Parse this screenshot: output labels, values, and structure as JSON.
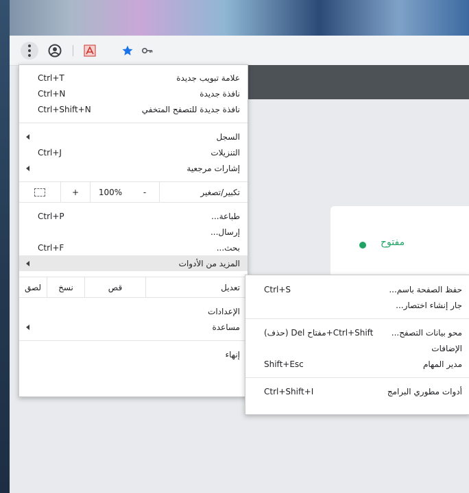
{
  "toolbar": {
    "menu_icon": "vertical-dots-icon",
    "profile_icon": "account-circle-icon",
    "pdf_icon": "acrobat-pdf-icon",
    "star_icon": "bookmark-star-icon",
    "key_icon": "key-icon"
  },
  "page": {
    "status_text": "مفتوح",
    "status_color": "#21a366"
  },
  "main_menu": {
    "new_tab": {
      "label": "علامة تبويب جديدة",
      "shortcut": "Ctrl+T"
    },
    "new_window": {
      "label": "نافذة جديدة",
      "shortcut": "Ctrl+N"
    },
    "incognito": {
      "label": "نافذة جديدة للتصفح المتخفي",
      "shortcut": "Ctrl+Shift+N"
    },
    "history": {
      "label": "السجل"
    },
    "downloads": {
      "label": "التنزيلات",
      "shortcut": "Ctrl+J"
    },
    "bookmarks": {
      "label": "إشارات مرجعية"
    },
    "zoom": {
      "label": "تكبير/تصغير",
      "minus": "-",
      "value": "100%",
      "plus": "+"
    },
    "print": {
      "label": "طباعة...",
      "shortcut": "Ctrl+P"
    },
    "cast": {
      "label": "إرسال..."
    },
    "find": {
      "label": "بحث...",
      "shortcut": "Ctrl+F"
    },
    "more_tools": {
      "label": "المزيد من الأدوات"
    },
    "edit": {
      "label": "تعديل",
      "cut": "قص",
      "copy": "نسخ",
      "paste": "لصق"
    },
    "settings": {
      "label": "الإعدادات"
    },
    "help": {
      "label": "مساعدة"
    },
    "exit": {
      "label": "إنهاء"
    }
  },
  "sub_menu": {
    "save_page": {
      "label": "حفظ الصفحة باسم...",
      "shortcut": "Ctrl+S"
    },
    "create_shortcut": {
      "label": "جار إنشاء اختصار..."
    },
    "clear_data": {
      "label": "محو بيانات التصفح...",
      "shortcut": "Ctrl+Shift+مفتاح Del (حذف)"
    },
    "extensions": {
      "label": "الإضافات"
    },
    "task_manager": {
      "label": "مدير المهام",
      "shortcut": "Shift+Esc"
    },
    "devtools": {
      "label": "أدوات مطوري البرامج",
      "shortcut": "Ctrl+Shift+I"
    }
  }
}
